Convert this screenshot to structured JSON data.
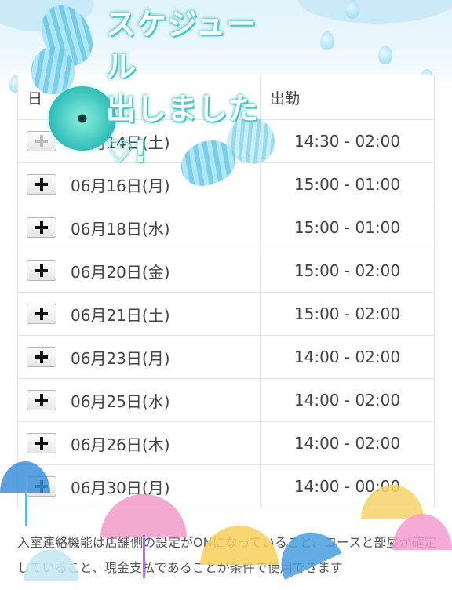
{
  "header": {
    "line1": "スケジュール",
    "line2": "出しました♡!"
  },
  "table": {
    "col_date": "日",
    "col_time": "出勤",
    "rows": [
      {
        "date": "06月14日(土)",
        "time": "14:30 - 02:00"
      },
      {
        "date": "06月16日(月)",
        "time": "15:00 - 01:00"
      },
      {
        "date": "06月18日(水)",
        "time": "15:00 - 01:00"
      },
      {
        "date": "06月20日(金)",
        "time": "15:00 - 02:00"
      },
      {
        "date": "06月21日(土)",
        "time": "15:00 - 02:00"
      },
      {
        "date": "06月23日(月)",
        "time": "14:00 - 02:00"
      },
      {
        "date": "06月25日(水)",
        "time": "14:00 - 02:00"
      },
      {
        "date": "06月26日(木)",
        "time": "14:00 - 02:00"
      },
      {
        "date": "06月30日(月)",
        "time": "14:00 - 00:00"
      }
    ]
  },
  "notice": "入室連絡機能は店舗側の設定がONになっていること、コースと部屋が確定していること、現金支払であることが条件で使用できます"
}
